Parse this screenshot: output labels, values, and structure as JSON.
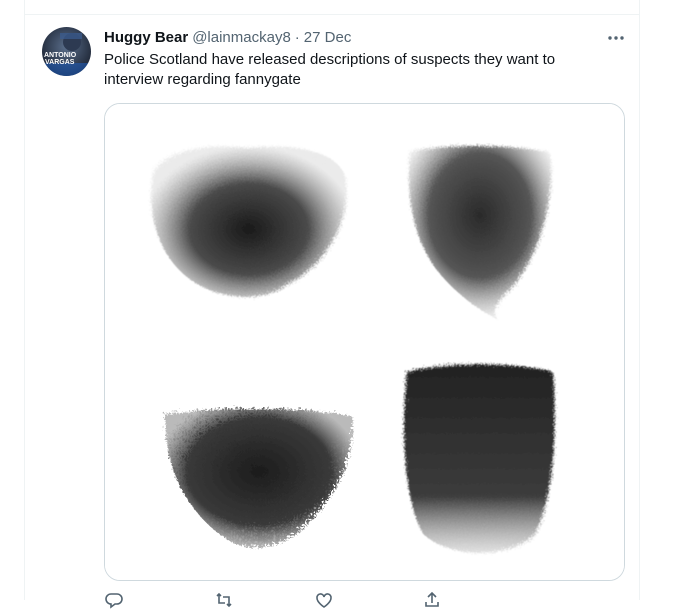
{
  "tweet": {
    "display_name": "Huggy Bear",
    "handle": "@lainmackay8",
    "separator": "·",
    "date": "27 Dec",
    "text": "Police Scotland have released descriptions of suspects they want to\ninterview regarding fannygate"
  },
  "avatar": {
    "text_line1": "ANTONIO",
    "text_line2": "VARGAS"
  },
  "icons": {
    "more": "more-horizontal-icon",
    "reply": "reply-icon",
    "retweet": "retweet-icon",
    "like": "like-icon",
    "share": "share-icon"
  },
  "colors": {
    "text_primary": "#0f1419",
    "text_secondary": "#536471",
    "border": "#cfd9de",
    "divider": "#eff3f4"
  }
}
